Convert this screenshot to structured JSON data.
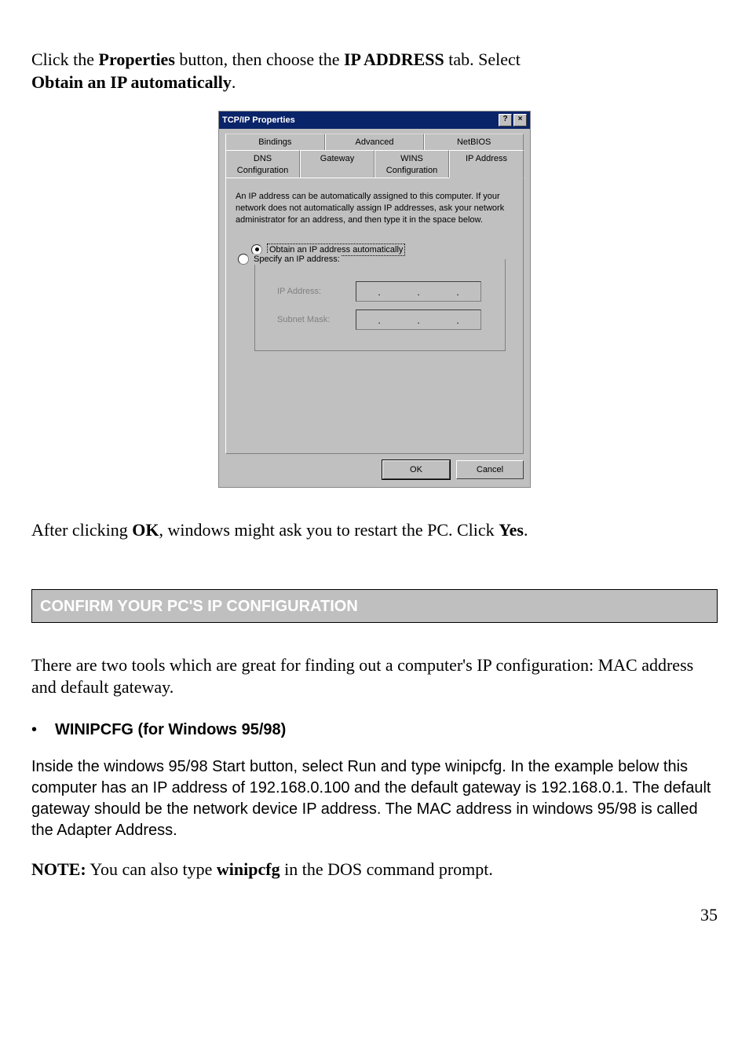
{
  "intro": {
    "pre": "Click the ",
    "b1": "Properties",
    "mid": " button, then choose the ",
    "b2": "IP ADDRESS",
    "end": " tab. Select ",
    "line2_b": "Obtain an IP automatically",
    "line2_end": "."
  },
  "dialog": {
    "title": "TCP/IP Properties",
    "help_glyph": "?",
    "close_glyph": "×",
    "tabs_back": [
      "Bindings",
      "Advanced",
      "NetBIOS"
    ],
    "tabs_front": [
      "DNS Configuration",
      "Gateway",
      "WINS Configuration",
      "IP Address"
    ],
    "info": "An IP address can be automatically assigned to this computer. If your network does not automatically assign IP addresses, ask your network administrator for an address, and then type it in the space below.",
    "opt_auto": "Obtain an IP address automatically",
    "opt_specify": "Specify an IP address:",
    "ip_label": "IP Address:",
    "subnet_label": "Subnet Mask:",
    "ok": "OK",
    "cancel": "Cancel"
  },
  "after": {
    "pre": "After clicking ",
    "b1": "OK",
    "mid": ", windows might ask you to restart the PC. Click ",
    "b2": "Yes",
    "end": "."
  },
  "section_title": "CONFIRM YOUR PC'S IP CONFIGURATION",
  "tools_text": "There are two tools which are great for finding out a computer's IP configuration: MAC address and default gateway.",
  "bullet1": "WINIPCFG (for Windows 95/98)",
  "para1": "Inside the windows 95/98 Start button, select Run and type winipcfg. In the example below this computer has an IP address of 192.168.0.100 and the default gateway is 192.168.0.1. The default gateway should be the network device IP address. The MAC address in windows 95/98 is called the Adapter Address.",
  "note": {
    "b1": "NOTE:",
    "mid": " You can also type ",
    "b2": "winipcfg",
    "end": " in the DOS command prompt."
  },
  "page_number": "35"
}
